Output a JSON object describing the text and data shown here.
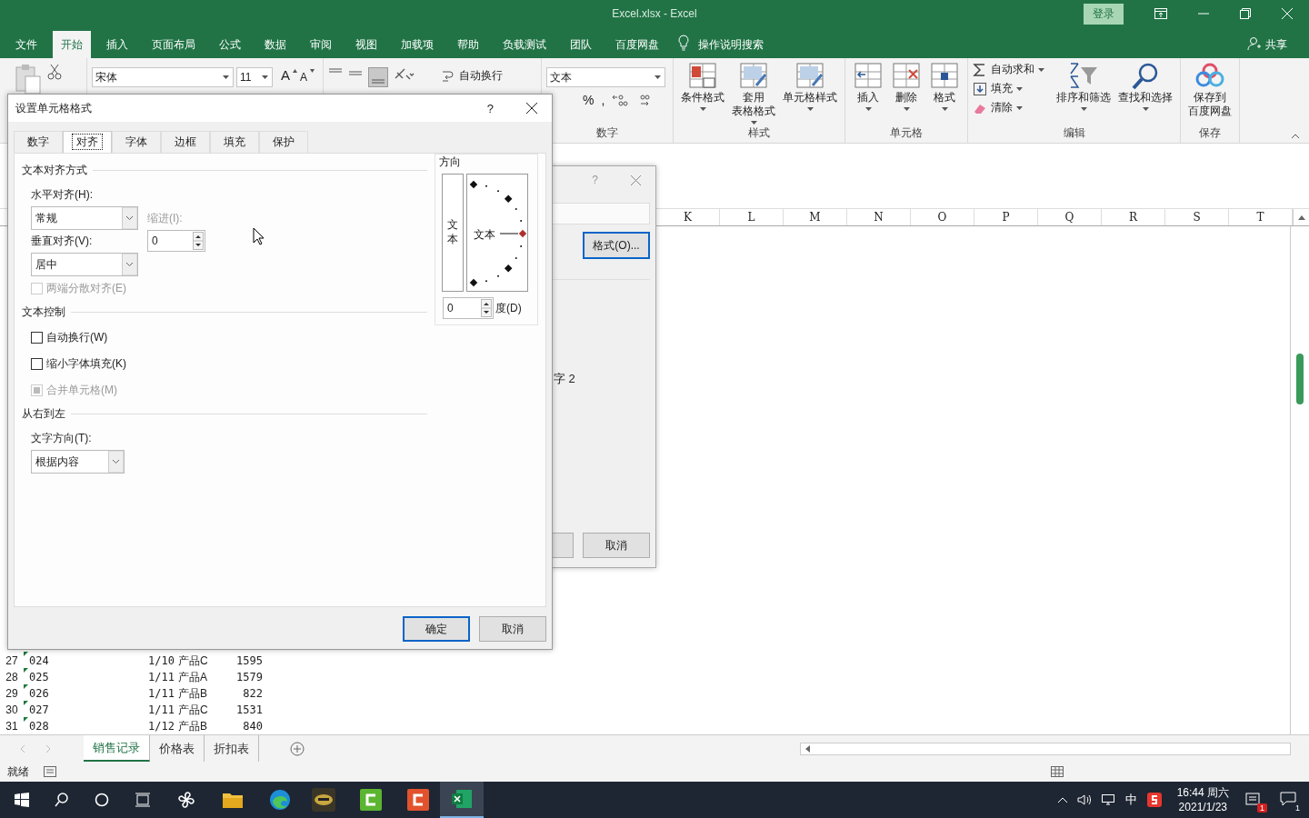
{
  "window": {
    "title": "Excel.xlsx  -  Excel",
    "sign_in": "登录"
  },
  "menu_tabs": [
    {
      "label": "文件",
      "selected": false
    },
    {
      "label": "开始",
      "selected": true
    },
    {
      "label": "插入",
      "selected": false
    },
    {
      "label": "页面布局",
      "selected": false
    },
    {
      "label": "公式",
      "selected": false
    },
    {
      "label": "数据",
      "selected": false
    },
    {
      "label": "审阅",
      "selected": false
    },
    {
      "label": "视图",
      "selected": false
    },
    {
      "label": "加载项",
      "selected": false
    },
    {
      "label": "帮助",
      "selected": false
    },
    {
      "label": "负载测试",
      "selected": false
    },
    {
      "label": "团队",
      "selected": false
    },
    {
      "label": "百度网盘",
      "selected": false
    }
  ],
  "tell_me": "操作说明搜索",
  "share": "共享",
  "ribbon": {
    "font_name": "宋体",
    "font_size": "11",
    "grow_font": "A",
    "shrink_font": "A",
    "wrap_text": "自动换行",
    "number_format": "文本",
    "percent": "%",
    "comma": ",",
    "number_label": "数字",
    "styles": {
      "label": "样式",
      "buttons": [
        {
          "lines": [
            "条件格式"
          ],
          "kind": "conditional"
        },
        {
          "lines": [
            "套用",
            "表格格式"
          ],
          "kind": "table"
        },
        {
          "lines": [
            "单元格样式"
          ],
          "kind": "cellstyle"
        }
      ]
    },
    "cells": {
      "label": "单元格",
      "buttons": [
        {
          "lines": [
            "插入"
          ],
          "kind": "insert"
        },
        {
          "lines": [
            "删除"
          ],
          "kind": "delete"
        },
        {
          "lines": [
            "格式"
          ],
          "kind": "format"
        }
      ]
    },
    "editing": {
      "label": "编辑",
      "small": [
        {
          "label": "自动求和",
          "kind": "sum"
        },
        {
          "label": "填充",
          "kind": "fill"
        },
        {
          "label": "清除",
          "kind": "clear"
        }
      ],
      "buttons": [
        {
          "lines": [
            "排序和筛选"
          ],
          "kind": "sort"
        },
        {
          "lines": [
            "查找和选择"
          ],
          "kind": "find"
        }
      ]
    },
    "save": {
      "label": "保存",
      "buttons": [
        {
          "lines": [
            "保存到",
            "百度网盘"
          ],
          "kind": "cloud"
        }
      ]
    }
  },
  "columns": [
    "K",
    "L",
    "M",
    "N",
    "O",
    "P",
    "Q",
    "R",
    "S",
    "T"
  ],
  "rows": [
    {
      "num": "27",
      "cells": [
        "024",
        "1/10",
        "产品C",
        "1595"
      ]
    },
    {
      "num": "28",
      "cells": [
        "025",
        "1/11",
        "产品A",
        "1579"
      ]
    },
    {
      "num": "29",
      "cells": [
        "026",
        "1/11",
        "产品B",
        "822"
      ]
    },
    {
      "num": "30",
      "cells": [
        "027",
        "1/11",
        "产品C",
        "1531"
      ]
    },
    {
      "num": "31",
      "cells": [
        "028",
        "1/12",
        "产品B",
        "840"
      ]
    }
  ],
  "back_dialog": {
    "help": "?",
    "format_button": "格式(O)...",
    "text": "字 2",
    "cancel": "取消"
  },
  "format_dialog": {
    "title": "设置单元格格式",
    "help": "?",
    "tabs": [
      {
        "label": "数字",
        "selected": false
      },
      {
        "label": "对齐",
        "selected": true
      },
      {
        "label": "字体",
        "selected": false
      },
      {
        "label": "边框",
        "selected": false
      },
      {
        "label": "填充",
        "selected": false
      },
      {
        "label": "保护",
        "selected": false
      }
    ],
    "text_alignment": {
      "heading": "文本对齐方式",
      "horizontal": {
        "label": "水平对齐(H):",
        "value": "常规"
      },
      "vertical": {
        "label": "垂直对齐(V):",
        "value": "居中"
      },
      "indent": {
        "label": "缩进(I):",
        "value": "0"
      },
      "distributed": {
        "label": "两端分散对齐(E)",
        "checked": false,
        "indeterminate": false,
        "disabled": true
      }
    },
    "text_control": {
      "heading": "文本控制",
      "options": [
        {
          "label": "自动换行(W)",
          "checked": false,
          "indeterminate": false,
          "disabled": false
        },
        {
          "label": "缩小字体填充(K)",
          "checked": false,
          "indeterminate": false,
          "disabled": false
        },
        {
          "label": "合并单元格(M)",
          "checked": false,
          "indeterminate": true,
          "disabled": true
        }
      ]
    },
    "right_to_left": {
      "heading": "从右到左",
      "label": "文字方向(T):",
      "value": "根据内容"
    },
    "orientation": {
      "heading": "方向",
      "vertical_text": "文本",
      "dial_text": "文本",
      "degrees": "0",
      "degrees_label": "度(D)"
    },
    "buttons": [
      {
        "label": "确定",
        "default": true
      },
      {
        "label": "取消",
        "default": false
      }
    ]
  },
  "sheet_tabs": [
    {
      "label": "销售记录",
      "selected": true
    },
    {
      "label": "价格表",
      "selected": false
    },
    {
      "label": "折扣表",
      "selected": false
    }
  ],
  "status": "就绪",
  "taskbar": {
    "ime": "中",
    "time": "16:44 周六",
    "date": "2021/1/23",
    "badge": "1",
    "notifications": "1"
  }
}
